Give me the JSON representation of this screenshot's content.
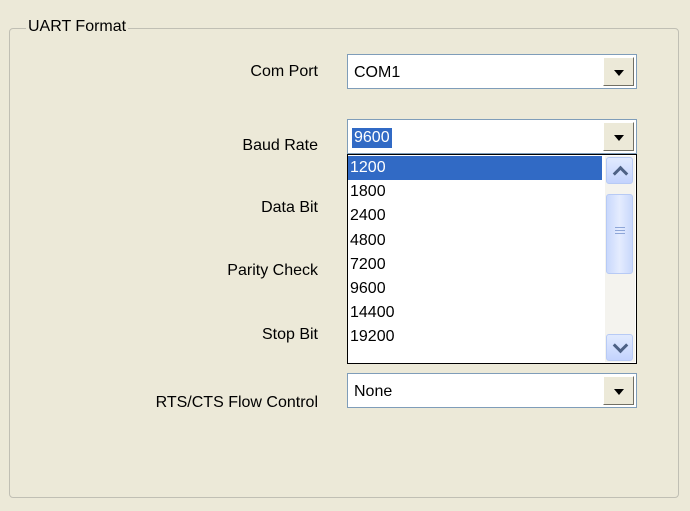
{
  "group": {
    "title": "UART Format"
  },
  "fields": {
    "com_port": {
      "label": "Com Port",
      "value": "COM1"
    },
    "baud_rate": {
      "label": "Baud Rate",
      "value": "9600"
    },
    "data_bit": {
      "label": "Data Bit"
    },
    "parity": {
      "label": "Parity Check"
    },
    "stop_bit": {
      "label": "Stop Bit"
    },
    "flow": {
      "label": "RTS/CTS Flow Control",
      "value": "None"
    }
  },
  "baud_dropdown": {
    "options": [
      "1200",
      "1800",
      "2400",
      "4800",
      "7200",
      "9600",
      "14400",
      "19200"
    ],
    "highlighted": "1200"
  },
  "icons": {
    "dropdown": "chevron-down-icon",
    "scroll_up": "chevron-up-icon",
    "scroll_down": "chevron-down-icon"
  },
  "colors": {
    "background": "#ece9d8",
    "highlight": "#316ac5",
    "field_border": "#7f9db9"
  }
}
